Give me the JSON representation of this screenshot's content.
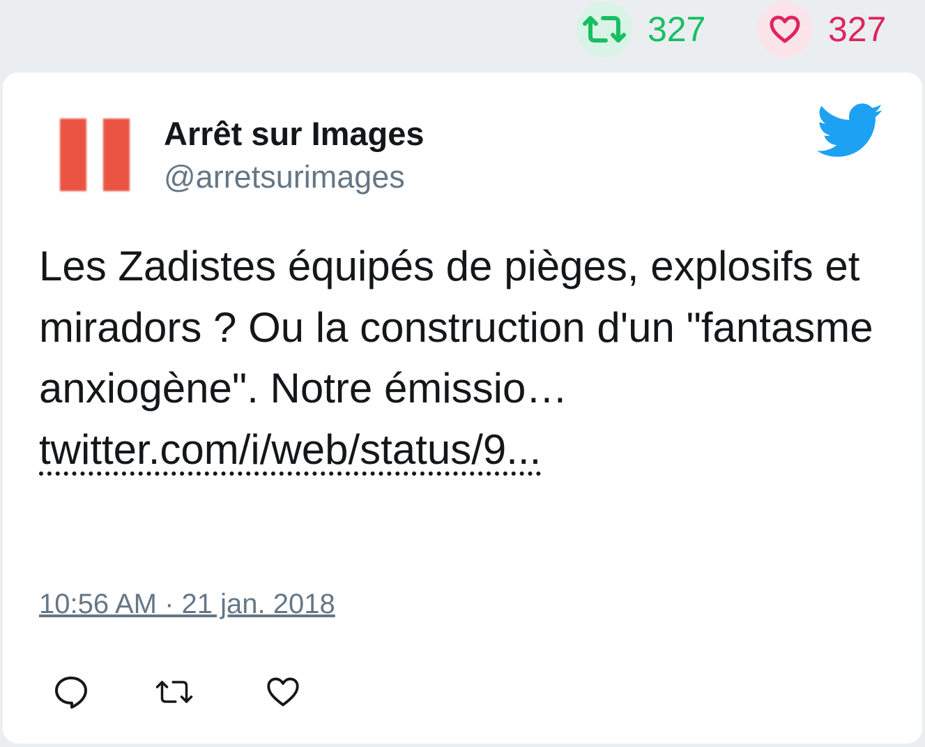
{
  "top_stats": {
    "retweet_count": "327",
    "like_count": "327"
  },
  "author": {
    "name": "Arrêt sur Images",
    "handle": "@arretsurimages"
  },
  "tweet": {
    "text": "Les Zadistes équipés de pièges, explosifs et miradors ? Ou la construction d'un \"fantasme anxiogène\". Notre émissio…",
    "link": "twitter.com/i/web/status/9...",
    "timestamp": "10:56 AM · 21 jan. 2018"
  },
  "icons": {
    "retweet": "retweet-icon",
    "like": "heart-icon",
    "reply": "reply-icon",
    "brand": "twitter-bird-icon"
  },
  "colors": {
    "retweet": "#17bf63",
    "like": "#e0245e",
    "brand": "#1da1f2",
    "avatar": "#ea5443",
    "muted": "#657786"
  }
}
